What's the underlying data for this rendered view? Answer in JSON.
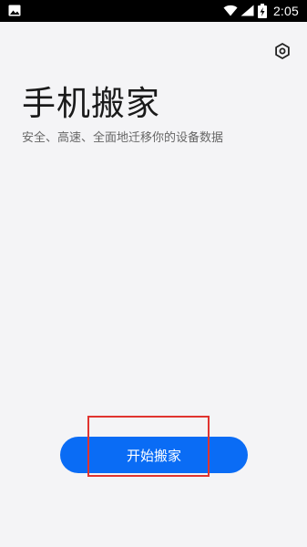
{
  "status_bar": {
    "time": "2:05",
    "left_icon": "image-icon",
    "wifi_icon": "wifi-icon",
    "signal_icon": "signal-icon",
    "battery_icon": "battery-charging-icon"
  },
  "header": {
    "settings_icon": "settings-icon"
  },
  "main": {
    "title": "手机搬家",
    "subtitle": "安全、高速、全面地迁移你的设备数据"
  },
  "action": {
    "start_label": "开始搬家"
  },
  "colors": {
    "background": "#f4f4f6",
    "accent": "#0a6cf5",
    "highlight": "#e0342f"
  }
}
